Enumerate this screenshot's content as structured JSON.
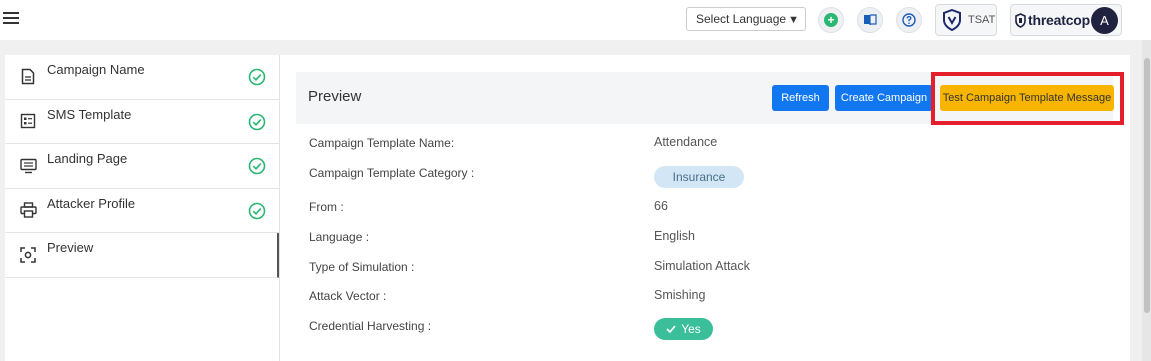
{
  "header": {
    "language_select": "Select Language",
    "tsat_label": "TSAT",
    "brand_name": "threatcop",
    "avatar_initial": "A"
  },
  "sidebar": {
    "steps": [
      {
        "label": "Campaign Name",
        "icon": "document-icon",
        "completed": true
      },
      {
        "label": "SMS Template",
        "icon": "template-icon",
        "completed": true
      },
      {
        "label": "Landing Page",
        "icon": "monitor-icon",
        "completed": true
      },
      {
        "label": "Attacker Profile",
        "icon": "printer-icon",
        "completed": true
      },
      {
        "label": "Preview",
        "icon": "scan-icon",
        "completed": false,
        "active": true
      }
    ]
  },
  "preview": {
    "title": "Preview",
    "refresh_label": "Refresh",
    "create_label": "Create Campaign",
    "test_label": "Test Campaign Template Message",
    "fields": [
      {
        "label": "Campaign Template Name:",
        "value": "Attendance"
      },
      {
        "label": "Campaign Template Category :",
        "value": "Insurance"
      },
      {
        "label": "From :",
        "value": "66"
      },
      {
        "label": "Language :",
        "value": "English"
      },
      {
        "label": "Type of Simulation :",
        "value": "Simulation Attack"
      },
      {
        "label": "Attack Vector :",
        "value": "Smishing"
      },
      {
        "label": "Credential Harvesting :",
        "value": "Yes"
      }
    ]
  },
  "colors": {
    "primary_blue": "#1177f0",
    "accent_yellow": "#f7b500",
    "highlight_red": "#e41e2a",
    "success_green": "#2bb673",
    "pill_green": "#3bbf9a",
    "pill_blue": "#d2e6f5",
    "brand_navy": "#1f2340"
  }
}
